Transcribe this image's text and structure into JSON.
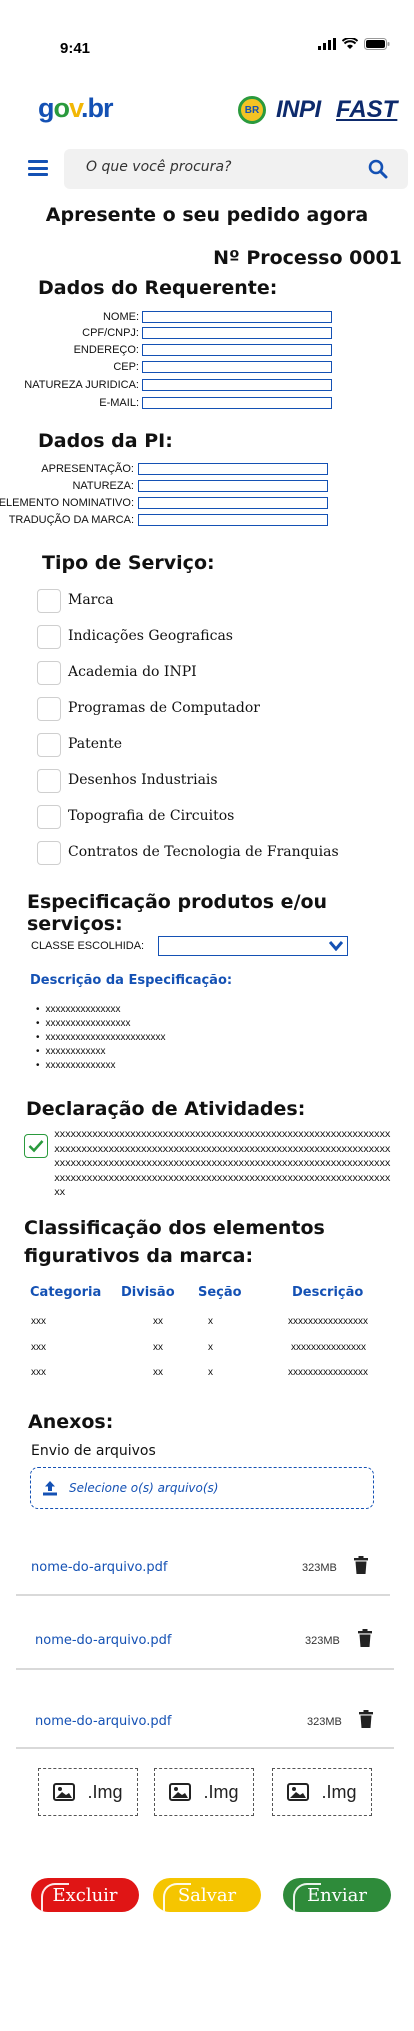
{
  "status_bar": {
    "time": "9:41"
  },
  "header": {
    "logo_parts": {
      "g": "g",
      "o": "o",
      "v": "v",
      "b": ".br"
    },
    "badge": "BR",
    "inpi": "INPI",
    "fast": "FAST"
  },
  "search": {
    "placeholder": "O que você procura?"
  },
  "page_title": "Apresente o seu pedido agora",
  "process_number": "Nº Processo 0001",
  "requerente": {
    "title": "Dados do Requerente:",
    "fields": [
      "NOME:",
      "CPF/CNPJ:",
      "ENDEREÇO:",
      "CEP:",
      "NATUREZA JURIDICA:",
      "E-MAIL:"
    ]
  },
  "pi": {
    "title": "Dados da PI:",
    "fields": [
      "APRESENTAÇÃO:",
      "NATUREZA:",
      "ELEMENTO NOMINATIVO:",
      "TRADUÇÃO DA MARCA:"
    ]
  },
  "servico": {
    "title": "Tipo de Serviço:",
    "options": [
      "Marca",
      "Indicações Geograficas",
      "Academia do INPI",
      "Programas de Computador",
      "Patente",
      "Desenhos Industriais",
      "Topografia de Circuitos",
      "Contratos de Tecnologia de Franquias"
    ]
  },
  "especificacao": {
    "title": "Especificação produtos e/ou serviços:",
    "class_label": "CLASSE ESCOLHIDA:",
    "subtitle": "Descrição da Especificação:",
    "items": [
      "xxxxxxxxxxxxxxx",
      "xxxxxxxxxxxxxxxxx",
      "xxxxxxxxxxxxxxxxxxxxxxxx",
      "xxxxxxxxxxxx",
      "xxxxxxxxxxxxxx"
    ]
  },
  "declaracao": {
    "title": "Declaração de Atividades:",
    "checked": true,
    "text": "xxxxxxxxxxxxxxxxxxxxxxxxxxxxxxxxxxxxxxxxxxxxxxxxxxxxxxxxxxxxxxxxxxxxxxxxxxxxxxxxxxxxxxxxxxxxxxxxxxxxxxxxxxxxxxxxxxxxxxxxxxxxxxxxxxxxxxxxxxxxxxxxxxxxxxxxxxxxxxxxxxxxxxxxxxxxxxxxxxxxxxxxxxxxxxxxxxxxxxxxxxxxxxxxxxxxxxxxxxxxxxxxxxxxxxxxxxxxxxxxxxxxxxxxxx"
  },
  "classificacao": {
    "title": "Classificação dos elementos figurativos da marca:",
    "headers": [
      "Categoria",
      "Divisão",
      "Seção",
      "Descrição"
    ],
    "rows": [
      [
        "xxx",
        "xx",
        "x",
        "xxxxxxxxxxxxxxxx"
      ],
      [
        "xxx",
        "xx",
        "x",
        "xxxxxxxxxxxxxxx"
      ],
      [
        "xxx",
        "xx",
        "x",
        "xxxxxxxxxxxxxxxx"
      ]
    ]
  },
  "anexos": {
    "title": "Anexos:",
    "subtitle": "Envio de arquivos",
    "upload_label": "Selecione o(s) arquivo(s)",
    "files": [
      {
        "name": "nome-do-arquivo.pdf",
        "size": "323MB"
      },
      {
        "name": "nome-do-arquivo.pdf",
        "size": "323MB"
      },
      {
        "name": "nome-do-arquivo.pdf",
        "size": "323MB"
      }
    ],
    "image_slots": [
      ".Img",
      ".Img",
      ".Img"
    ]
  },
  "actions": {
    "excluir": "Excluir",
    "salvar": "Salvar",
    "enviar": "Enviar"
  },
  "colors": {
    "primary": "#1451b4",
    "excluir": "#e01515",
    "salvar": "#f5c500",
    "enviar": "#2e8b3a"
  },
  "icons": [
    "menu-icon",
    "search-icon",
    "upload-icon",
    "trash-icon",
    "image-icon",
    "check-icon",
    "chevron-down-icon",
    "signal-icon",
    "wifi-icon",
    "battery-icon"
  ]
}
